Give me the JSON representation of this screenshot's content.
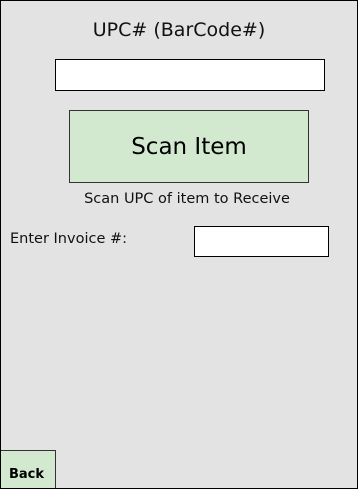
{
  "screen": {
    "upc_label": "UPC# (BarCode#)",
    "upc_value": "",
    "scan_button_label": "Scan Item",
    "scan_hint": "Scan UPC of item to Receive",
    "invoice_label": "Enter Invoice #:",
    "invoice_value": "",
    "back_button_label": "Back"
  },
  "colors": {
    "background": "#e3e3e3",
    "button_fill": "#d2e9cf",
    "input_fill": "#ffffff"
  }
}
